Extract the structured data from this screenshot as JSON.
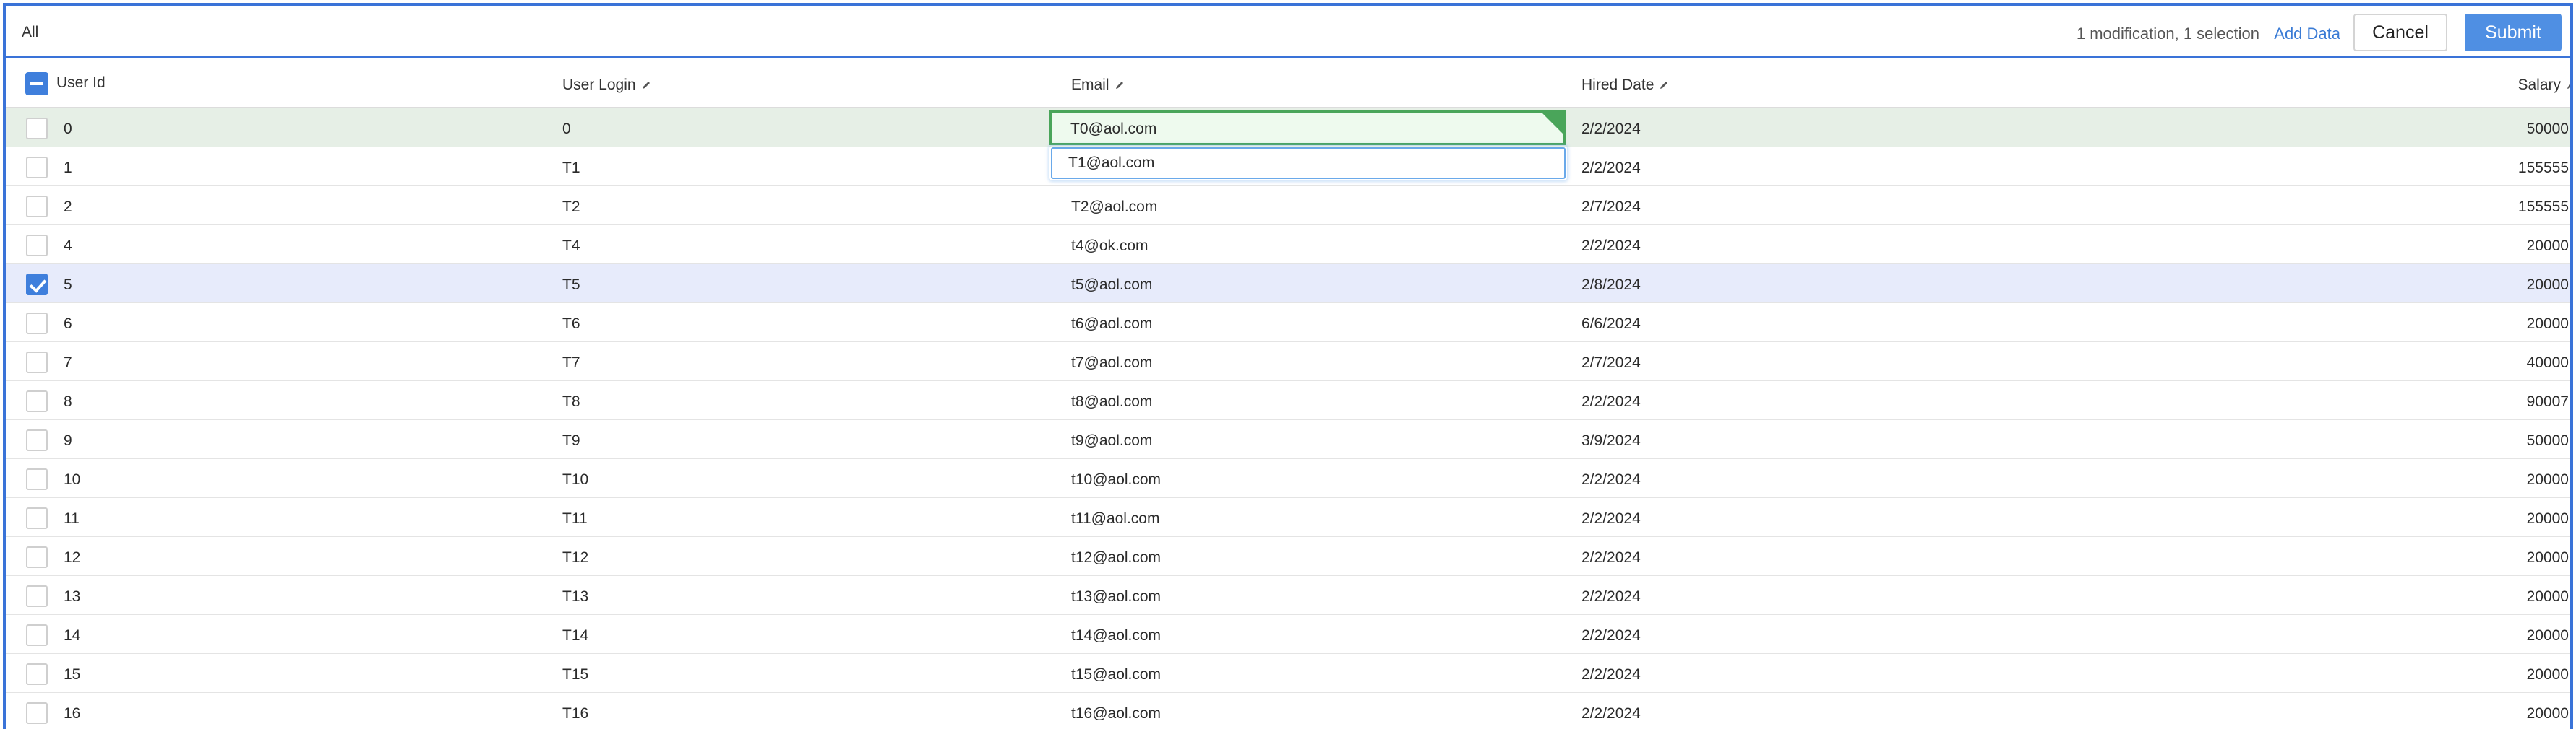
{
  "toolbar": {
    "filter_label": "All",
    "status": "1 modification, 1 selection",
    "add_data": "Add Data",
    "cancel": "Cancel",
    "submit": "Submit"
  },
  "columns": {
    "user_id": "User Id",
    "user_login": "User Login",
    "email": "Email",
    "hired_date": "Hired Date",
    "salary": "Salary"
  },
  "editor": {
    "value": "T1@aol.com"
  },
  "rows": [
    {
      "id": "0",
      "login": "0",
      "email": "T0@aol.com",
      "hired": "2/2/2024",
      "salary": "50000",
      "checked": false,
      "edited": true
    },
    {
      "id": "1",
      "login": "T1",
      "email": "",
      "hired": "2/2/2024",
      "salary": "155555",
      "checked": false,
      "edited": false
    },
    {
      "id": "2",
      "login": "T2",
      "email": "T2@aol.com",
      "hired": "2/7/2024",
      "salary": "155555",
      "checked": false,
      "edited": false
    },
    {
      "id": "4",
      "login": "T4",
      "email": "t4@ok.com",
      "hired": "2/2/2024",
      "salary": "20000",
      "checked": false,
      "edited": false
    },
    {
      "id": "5",
      "login": "T5",
      "email": "t5@aol.com",
      "hired": "2/8/2024",
      "salary": "20000",
      "checked": true,
      "edited": false
    },
    {
      "id": "6",
      "login": "T6",
      "email": "t6@aol.com",
      "hired": "6/6/2024",
      "salary": "20000",
      "checked": false,
      "edited": false
    },
    {
      "id": "7",
      "login": "T7",
      "email": "t7@aol.com",
      "hired": "2/7/2024",
      "salary": "40000",
      "checked": false,
      "edited": false
    },
    {
      "id": "8",
      "login": "T8",
      "email": "t8@aol.com",
      "hired": "2/2/2024",
      "salary": "90007",
      "checked": false,
      "edited": false
    },
    {
      "id": "9",
      "login": "T9",
      "email": "t9@aol.com",
      "hired": "3/9/2024",
      "salary": "50000",
      "checked": false,
      "edited": false
    },
    {
      "id": "10",
      "login": "T10",
      "email": "t10@aol.com",
      "hired": "2/2/2024",
      "salary": "20000",
      "checked": false,
      "edited": false
    },
    {
      "id": "11",
      "login": "T11",
      "email": "t11@aol.com",
      "hired": "2/2/2024",
      "salary": "20000",
      "checked": false,
      "edited": false
    },
    {
      "id": "12",
      "login": "T12",
      "email": "t12@aol.com",
      "hired": "2/2/2024",
      "salary": "20000",
      "checked": false,
      "edited": false
    },
    {
      "id": "13",
      "login": "T13",
      "email": "t13@aol.com",
      "hired": "2/2/2024",
      "salary": "20000",
      "checked": false,
      "edited": false
    },
    {
      "id": "14",
      "login": "T14",
      "email": "t14@aol.com",
      "hired": "2/2/2024",
      "salary": "20000",
      "checked": false,
      "edited": false
    },
    {
      "id": "15",
      "login": "T15",
      "email": "t15@aol.com",
      "hired": "2/2/2024",
      "salary": "20000",
      "checked": false,
      "edited": false
    },
    {
      "id": "16",
      "login": "T16",
      "email": "t16@aol.com",
      "hired": "2/2/2024",
      "salary": "20000",
      "checked": false,
      "edited": false
    }
  ]
}
